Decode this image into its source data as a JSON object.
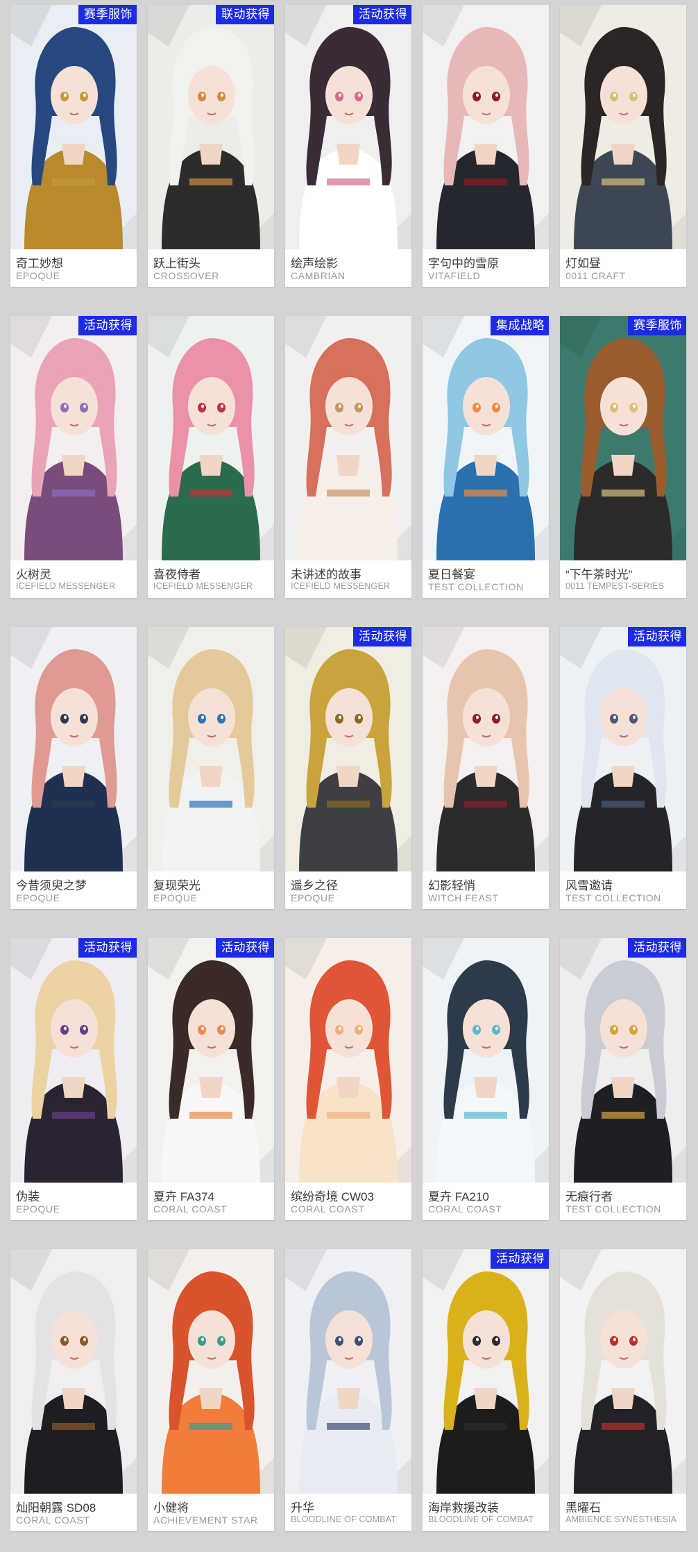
{
  "cards": [
    {
      "name": "奇工妙想",
      "series": "EPOQUE",
      "badge": "赛季服饰",
      "colors": {
        "bg": "#e9eef4",
        "hair": "#27487f",
        "accent": "#c59a3a",
        "outfit": "#b88a2c"
      }
    },
    {
      "name": "跃上街头",
      "series": "CROSSOVER",
      "badge": "联动获得",
      "colors": {
        "bg": "#ecece9",
        "hair": "#f1f1ee",
        "accent": "#d08a43",
        "outfit": "#2c2c2c"
      }
    },
    {
      "name": "绘声绘影",
      "series": "CAMBRIAN",
      "badge": "活动获得",
      "colors": {
        "bg": "#efefef",
        "hair": "#3b2b36",
        "accent": "#d66b8f",
        "outfit": "#ffffff"
      }
    },
    {
      "name": "字句中的雪原",
      "series": "VITAFIELD",
      "badge": "",
      "colors": {
        "bg": "#f1f1f2",
        "hair": "#e8b8b9",
        "accent": "#8e1b22",
        "outfit": "#25272e"
      }
    },
    {
      "name": "灯如昼",
      "series": "0011 CRAFT",
      "badge": "",
      "colors": {
        "bg": "#efece4",
        "hair": "#2c2525",
        "accent": "#d7c07a",
        "outfit": "#3d4753"
      }
    },
    {
      "name": "火树灵",
      "series": "ICEFIELD MESSENGER",
      "badge": "活动获得",
      "colors": {
        "bg": "#f3eef0",
        "hair": "#e9a4b5",
        "accent": "#8a6fc2",
        "outfit": "#7a4c7c"
      }
    },
    {
      "name": "喜夜侍者",
      "series": "ICEFIELD MESSENGER",
      "badge": "",
      "colors": {
        "bg": "#eef2ee",
        "hair": "#ea93a8",
        "accent": "#c72e3c",
        "outfit": "#2c6b4d"
      }
    },
    {
      "name": "未讲述的故事",
      "series": "ICEFIELD MESSENGER",
      "badge": "",
      "colors": {
        "bg": "#f2f0ee",
        "hair": "#d7705d",
        "accent": "#c79463",
        "outfit": "#f5efe8"
      }
    },
    {
      "name": "夏日餐宴",
      "series": "TEST COLLECTION",
      "badge": "集成战略",
      "colors": {
        "bg": "#f0f4f6",
        "hair": "#8fc7e5",
        "accent": "#f08a3b",
        "outfit": "#2a6fae"
      }
    },
    {
      "name": "“下午茶时光”",
      "series": "0011 TEMPEST-SERIES",
      "badge": "赛季服饰",
      "colors": {
        "bg": "#3d7a6d",
        "hair": "#9a5b2e",
        "accent": "#d8c07f",
        "outfit": "#2d2b2a"
      }
    },
    {
      "name": "今昔须臾之梦",
      "series": "EPOQUE",
      "badge": "",
      "colors": {
        "bg": "#eef0f3",
        "hair": "#e09a93",
        "accent": "#2c3a50",
        "outfit": "#1f3050"
      }
    },
    {
      "name": "复现荣光",
      "series": "EPOQUE",
      "badge": "",
      "colors": {
        "bg": "#f1efea",
        "hair": "#e4c99a",
        "accent": "#2e74b8",
        "outfit": "#f2f2f2"
      }
    },
    {
      "name": "遥乡之径",
      "series": "EPOQUE",
      "badge": "活动获得",
      "colors": {
        "bg": "#f0ede2",
        "hair": "#c9a43c",
        "accent": "#8a6a23",
        "outfit": "#3d3f45"
      }
    },
    {
      "name": "幻影轻悄",
      "series": "WITCH FEAST",
      "badge": "",
      "colors": {
        "bg": "#f3f0ef",
        "hair": "#e8c4ad",
        "accent": "#8b1f2b",
        "outfit": "#2b2a2c"
      }
    },
    {
      "name": "风雪邀请",
      "series": "TEST COLLECTION",
      "badge": "活动获得",
      "colors": {
        "bg": "#eef1f4",
        "hair": "#dfe6ef",
        "accent": "#4a5a72",
        "outfit": "#232529"
      }
    },
    {
      "name": "伪装",
      "series": "EPOQUE",
      "badge": "活动获得",
      "colors": {
        "bg": "#efedf1",
        "hair": "#ecd3a3",
        "accent": "#6a3e8c",
        "outfit": "#2a2432"
      }
    },
    {
      "name": "夏卉 FA374",
      "series": "CORAL COAST",
      "badge": "活动获得",
      "colors": {
        "bg": "#f3f1ee",
        "hair": "#3a2b29",
        "accent": "#e98a4a",
        "outfit": "#f7f7f7"
      }
    },
    {
      "name": "缤纷奇境 CW03",
      "series": "CORAL COAST",
      "badge": "",
      "colors": {
        "bg": "#f6efe9",
        "hair": "#e05535",
        "accent": "#f0b07a",
        "outfit": "#f6e3c8"
      }
    },
    {
      "name": "夏卉 FA210",
      "series": "CORAL COAST",
      "badge": "",
      "colors": {
        "bg": "#eef3f6",
        "hair": "#2c3b4a",
        "accent": "#59b6cf",
        "outfit": "#f4f7f9"
      }
    },
    {
      "name": "无痕行者",
      "series": "TEST COLLECTION",
      "badge": "活动获得",
      "colors": {
        "bg": "#eeeeee",
        "hair": "#c8ccd3",
        "accent": "#d4a43a",
        "outfit": "#1e1f22"
      }
    },
    {
      "name": "灿阳朝露 SD08",
      "series": "CORAL COAST",
      "badge": "",
      "colors": {
        "bg": "#efeff1",
        "hair": "#e3e3e6",
        "accent": "#8a5a2b",
        "outfit": "#1d1d22"
      }
    },
    {
      "name": "小健将",
      "series": "ACHIEVEMENT STAR",
      "badge": "",
      "colors": {
        "bg": "#f2efec",
        "hair": "#d9532c",
        "accent": "#3a9c8a",
        "outfit": "#f07d3a"
      }
    },
    {
      "name": "升华",
      "series": "BLOODLINE OF COMBAT",
      "badge": "",
      "colors": {
        "bg": "#eef0f3",
        "hair": "#b9c6d8",
        "accent": "#3c4f73",
        "outfit": "#e8ecf2"
      }
    },
    {
      "name": "海岸救援改装",
      "series": "BLOODLINE OF COMBAT",
      "badge": "活动获得",
      "colors": {
        "bg": "#f1f1ef",
        "hair": "#d9b21b",
        "accent": "#2b2b2b",
        "outfit": "#1c1c1c"
      }
    },
    {
      "name": "黑曜石",
      "series": "AMBIENCE SYNESTHESIA",
      "badge": "",
      "colors": {
        "bg": "#f2f2f2",
        "hair": "#e6e1d8",
        "accent": "#b7322c",
        "outfit": "#222226"
      }
    }
  ]
}
